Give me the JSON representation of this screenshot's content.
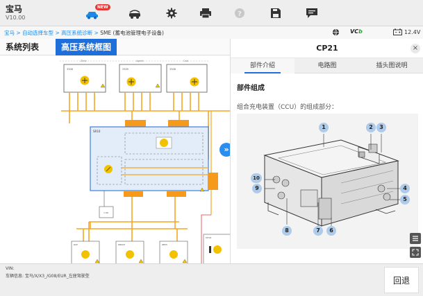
{
  "app": {
    "title": "宝马",
    "version": "V10.00"
  },
  "toolbar": {
    "new_badge": "NEW",
    "icons": [
      "home-car-icon",
      "car-service-icon",
      "settings-gear-icon",
      "print-icon",
      "help-icon",
      "save-icon",
      "message-icon"
    ]
  },
  "breadcrumb": {
    "items": [
      "宝马",
      "自动选择车型",
      "高压系统诊断"
    ],
    "separator": " > ",
    "current": "SME (蓄电池管理电子设备)"
  },
  "status": {
    "vcb_prefix": "VC",
    "voltage": "12.4V"
  },
  "left_tabs": {
    "system_list": "系统列表",
    "hv_diagram": "高压系统框图"
  },
  "diagram": {
    "top_labels": [
      "Ziele",
      "Agent",
      "Cab"
    ],
    "component_ids": [
      "3308",
      "3309",
      "3308"
    ],
    "main_box_label": "SR10",
    "small_label": "7-98",
    "bottom_labels": [
      "RCE",
      "RB6CE",
      "ZB55",
      "MT18"
    ]
  },
  "right_panel": {
    "title": "CP21",
    "close_label": "×",
    "tabs": [
      "部件介绍",
      "电路图",
      "插头图说明"
    ],
    "section_title": "部件组成",
    "section_desc": "组合充电装置（CCU）的组成部分：",
    "callouts": [
      "1",
      "2",
      "3",
      "4",
      "5",
      "6",
      "7",
      "8",
      "9",
      "10"
    ],
    "side_buttons": [
      "list-icon",
      "fullscreen-icon"
    ]
  },
  "bottom": {
    "vin_label": "VIN:",
    "vehicle_info": "车辆信息: 宝马/X/X3_/G08/EUR_左座驾驶型",
    "back_label": "回退"
  },
  "colors": {
    "accent": "#1e6fd9",
    "wire": "#f5a623",
    "warning": "#f2c200",
    "hv": "#f59a1b"
  }
}
